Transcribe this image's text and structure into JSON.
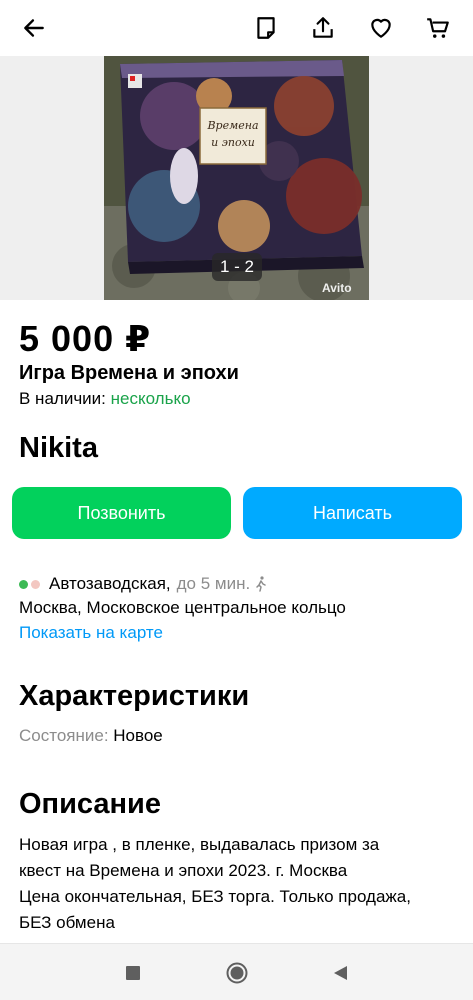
{
  "toolbar": {
    "icons": [
      "back-arrow-icon",
      "note-icon",
      "share-icon",
      "heart-icon",
      "cart-icon"
    ]
  },
  "gallery": {
    "counter": "1 - 2",
    "watermark": "Avito",
    "box_title": "Времена и эпохи"
  },
  "listing": {
    "price": "5 000 ₽",
    "title": "Игра Времена и эпохи",
    "availability_label": "В наличии: ",
    "availability_value": "несколько"
  },
  "seller": {
    "name": "Nikita"
  },
  "actions": {
    "call_label": "Позвонить",
    "write_label": "Написать",
    "call_color": "#02d15c",
    "write_color": "#00aaff"
  },
  "location": {
    "metro": "Автозаводская,",
    "walk_time": "до 5 мин.",
    "line_colors": [
      "#3dba56",
      "#f3c7c1"
    ],
    "address": "Москва, Московское центральное кольцо",
    "map_link": "Показать на карте"
  },
  "specs": {
    "heading": "Характеристики",
    "condition_label": "Состояние: ",
    "condition_value": "Новое"
  },
  "description": {
    "heading": "Описание",
    "lines": [
      "Новая игра , в пленке, выдавалась призом за",
      "квест на Времена и эпохи 2023. г. Москва",
      "Цена окончательная, БЕЗ торга. Только продажа,",
      "БЕЗ обмена"
    ]
  },
  "system_nav": {
    "icons": [
      "recents-square-icon",
      "home-circle-icon",
      "back-triangle-icon"
    ]
  }
}
